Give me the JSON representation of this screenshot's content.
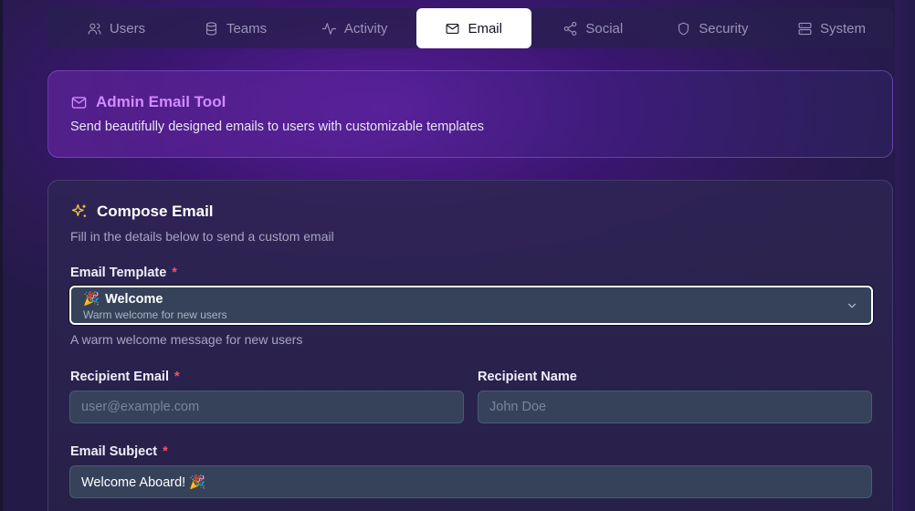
{
  "tabs": [
    {
      "label": "Users",
      "icon": "users-icon"
    },
    {
      "label": "Teams",
      "icon": "database-icon"
    },
    {
      "label": "Activity",
      "icon": "activity-icon"
    },
    {
      "label": "Email",
      "icon": "mail-icon",
      "active": true
    },
    {
      "label": "Social",
      "icon": "share-icon"
    },
    {
      "label": "Security",
      "icon": "shield-icon"
    },
    {
      "label": "System",
      "icon": "server-icon"
    }
  ],
  "info": {
    "title": "Admin Email Tool",
    "subtitle": "Send beautifully designed emails to users with customizable templates"
  },
  "compose": {
    "title": "Compose Email",
    "subtitle": "Fill in the details below to send a custom email",
    "template": {
      "label": "Email Template",
      "required_mark": "*",
      "selected_emoji": "🎉",
      "selected_name": "Welcome",
      "selected_desc": "Warm welcome for new users",
      "helper": "A warm welcome message for new users"
    },
    "recipient_email": {
      "label": "Recipient Email",
      "required_mark": "*",
      "placeholder": "user@example.com",
      "value": ""
    },
    "recipient_name": {
      "label": "Recipient Name",
      "placeholder": "John Doe",
      "value": ""
    },
    "subject": {
      "label": "Email Subject",
      "required_mark": "*",
      "value": "Welcome Aboard! 🎉"
    }
  },
  "colors": {
    "accent": "#d18bff",
    "required": "#ff4d6d",
    "sparkle": "#f5c542",
    "input_bg": "#35425a"
  }
}
